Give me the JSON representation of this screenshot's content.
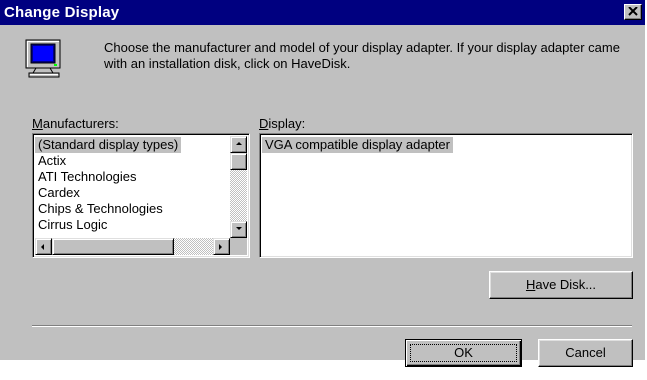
{
  "window": {
    "title": "Change Display"
  },
  "intro": {
    "text": "Choose the manufacturer and model of your display adapter.  If your display adapter came with an installation disk, click on HaveDisk."
  },
  "manufacturers": {
    "label_accel": "M",
    "label_rest": "anufacturers:",
    "items": [
      "(Standard display types)",
      "Actix",
      "ATI Technologies",
      "Cardex",
      "Chips & Technologies",
      "Cirrus Logic"
    ],
    "selected_index": 0
  },
  "display": {
    "label_accel": "D",
    "label_rest": "isplay:",
    "items": [
      "VGA compatible display adapter"
    ],
    "selected_index": 0
  },
  "buttons": {
    "have_disk_accel": "H",
    "have_disk_rest": "ave Disk...",
    "ok": "OK",
    "cancel": "Cancel"
  },
  "icons": {
    "window_close": "close-icon",
    "monitor": "monitor-icon",
    "scroll_up": "arrow-up-icon",
    "scroll_down": "arrow-down-icon",
    "scroll_left": "arrow-left-icon",
    "scroll_right": "arrow-right-icon"
  },
  "colors": {
    "titlebar": "#000080",
    "face": "#c0c0c0",
    "selection": "#c0c0c0"
  }
}
